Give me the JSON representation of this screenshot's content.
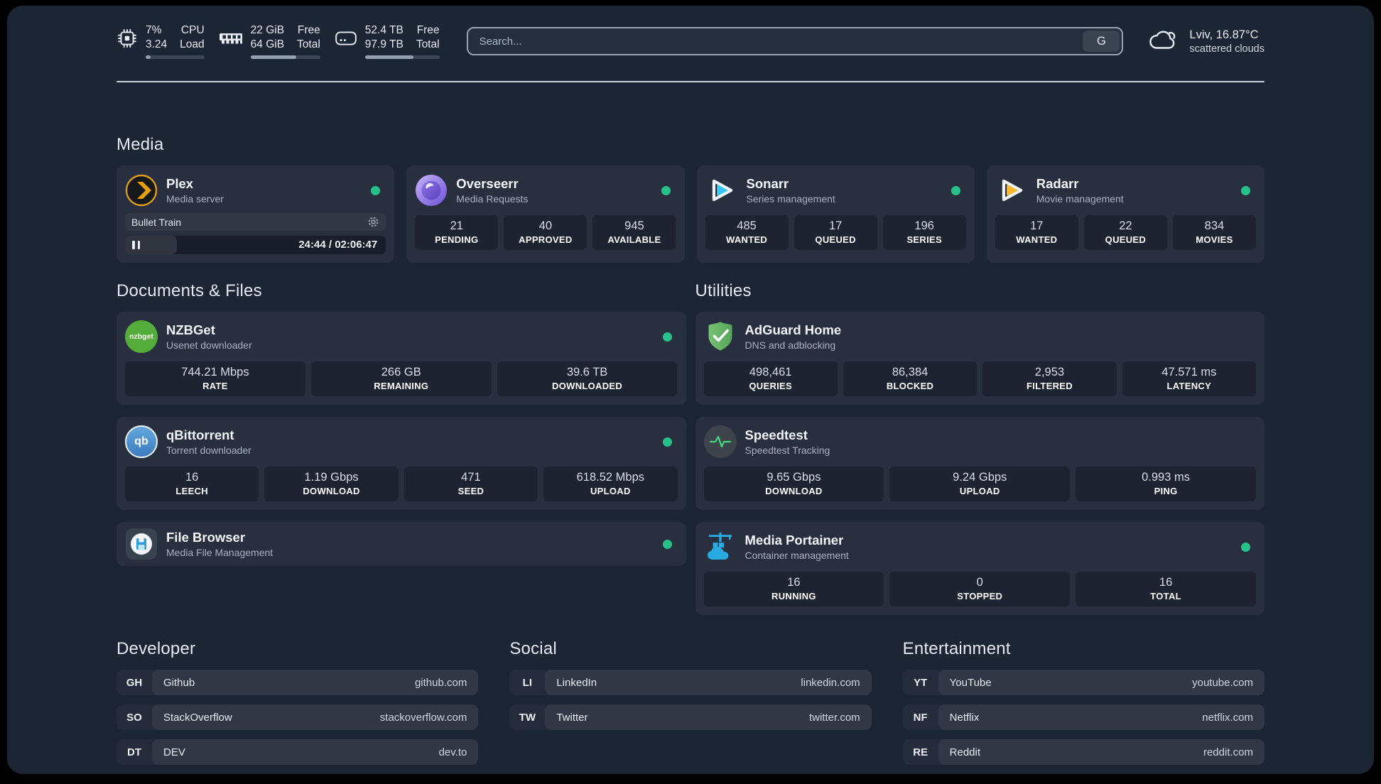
{
  "topbar": {
    "cpu": {
      "percent": "7%",
      "load": "3.24",
      "label_top": "CPU",
      "label_bottom": "Load",
      "progress_percent": 8
    },
    "memory": {
      "free": "22 GiB",
      "total": "64 GiB",
      "label_top": "Free",
      "label_bottom": "Total",
      "progress_percent": 66
    },
    "disk": {
      "free": "52.4 TB",
      "total": "97.9 TB",
      "label_top": "Free",
      "label_bottom": "Total",
      "progress_percent": 65
    },
    "search": {
      "placeholder": "Search...",
      "provider_button": "G"
    },
    "weather": {
      "headline": "Lviv, 16.87°C",
      "condition": "scattered clouds"
    }
  },
  "sections": {
    "media": "Media",
    "documents": "Documents & Files",
    "utilities": "Utilities",
    "developer": "Developer",
    "social": "Social",
    "entertainment": "Entertainment"
  },
  "services": {
    "plex": {
      "name": "Plex",
      "description": "Media server",
      "status": "online",
      "now_playing": "Bullet Train",
      "time": "24:44 / 02:06:47",
      "progress_percent": 20
    },
    "overseerr": {
      "name": "Overseerr",
      "description": "Media Requests",
      "status": "online",
      "stats": [
        {
          "value": "21",
          "label": "PENDING"
        },
        {
          "value": "40",
          "label": "APPROVED"
        },
        {
          "value": "945",
          "label": "AVAILABLE"
        }
      ]
    },
    "sonarr": {
      "name": "Sonarr",
      "description": "Series management",
      "status": "online",
      "stats": [
        {
          "value": "485",
          "label": "WANTED"
        },
        {
          "value": "17",
          "label": "QUEUED"
        },
        {
          "value": "196",
          "label": "SERIES"
        }
      ]
    },
    "radarr": {
      "name": "Radarr",
      "description": "Movie management",
      "status": "online",
      "stats": [
        {
          "value": "17",
          "label": "WANTED"
        },
        {
          "value": "22",
          "label": "QUEUED"
        },
        {
          "value": "834",
          "label": "MOVIES"
        }
      ]
    },
    "nzbget": {
      "name": "NZBGet",
      "description": "Usenet downloader",
      "status": "online",
      "icon_text": "nzbget",
      "stats": [
        {
          "value": "744.21 Mbps",
          "label": "RATE"
        },
        {
          "value": "266 GB",
          "label": "REMAINING"
        },
        {
          "value": "39.6 TB",
          "label": "DOWNLOADED"
        }
      ]
    },
    "qbittorrent": {
      "name": "qBittorrent",
      "description": "Torrent downloader",
      "status": "online",
      "icon_text": "qb",
      "stats": [
        {
          "value": "16",
          "label": "LEECH"
        },
        {
          "value": "1.19 Gbps",
          "label": "DOWNLOAD"
        },
        {
          "value": "471",
          "label": "SEED"
        },
        {
          "value": "618.52 Mbps",
          "label": "UPLOAD"
        }
      ]
    },
    "filebrowser": {
      "name": "File Browser",
      "description": "Media File Management",
      "status": "online"
    },
    "adguard": {
      "name": "AdGuard Home",
      "description": "DNS and adblocking",
      "stats": [
        {
          "value": "498,461",
          "label": "QUERIES"
        },
        {
          "value": "86,384",
          "label": "BLOCKED"
        },
        {
          "value": "2,953",
          "label": "FILTERED"
        },
        {
          "value": "47.571 ms",
          "label": "LATENCY"
        }
      ]
    },
    "speedtest": {
      "name": "Speedtest",
      "description": "Speedtest Tracking",
      "stats": [
        {
          "value": "9.65 Gbps",
          "label": "DOWNLOAD"
        },
        {
          "value": "9.24 Gbps",
          "label": "UPLOAD"
        },
        {
          "value": "0.993 ms",
          "label": "PING"
        }
      ]
    },
    "portainer": {
      "name": "Media Portainer",
      "description": "Container management",
      "status": "online",
      "stats": [
        {
          "value": "16",
          "label": "RUNNING"
        },
        {
          "value": "0",
          "label": "STOPPED"
        },
        {
          "value": "16",
          "label": "TOTAL"
        }
      ]
    }
  },
  "links": {
    "developer": [
      {
        "abbr": "GH",
        "name": "Github",
        "url": "github.com"
      },
      {
        "abbr": "SO",
        "name": "StackOverflow",
        "url": "stackoverflow.com"
      },
      {
        "abbr": "DT",
        "name": "DEV",
        "url": "dev.to"
      }
    ],
    "social": [
      {
        "abbr": "LI",
        "name": "LinkedIn",
        "url": "linkedin.com"
      },
      {
        "abbr": "TW",
        "name": "Twitter",
        "url": "twitter.com"
      }
    ],
    "entertainment": [
      {
        "abbr": "YT",
        "name": "YouTube",
        "url": "youtube.com"
      },
      {
        "abbr": "NF",
        "name": "Netflix",
        "url": "netflix.com"
      },
      {
        "abbr": "RE",
        "name": "Reddit",
        "url": "reddit.com"
      }
    ]
  },
  "colors": {
    "status_online": "#27c28a",
    "plex_accent": "#e5a00d",
    "sonarr_accent": "#38c6f4",
    "radarr_accent": "#ffb829",
    "nzbget_accent": "#54ad3a",
    "qbittorrent_accent": "#4a90d9",
    "adguard_accent": "#67b279",
    "speedtest_pulse": "#41d97e",
    "portainer_accent": "#29abe2",
    "overseerr_accent": "#7c5fe0"
  }
}
